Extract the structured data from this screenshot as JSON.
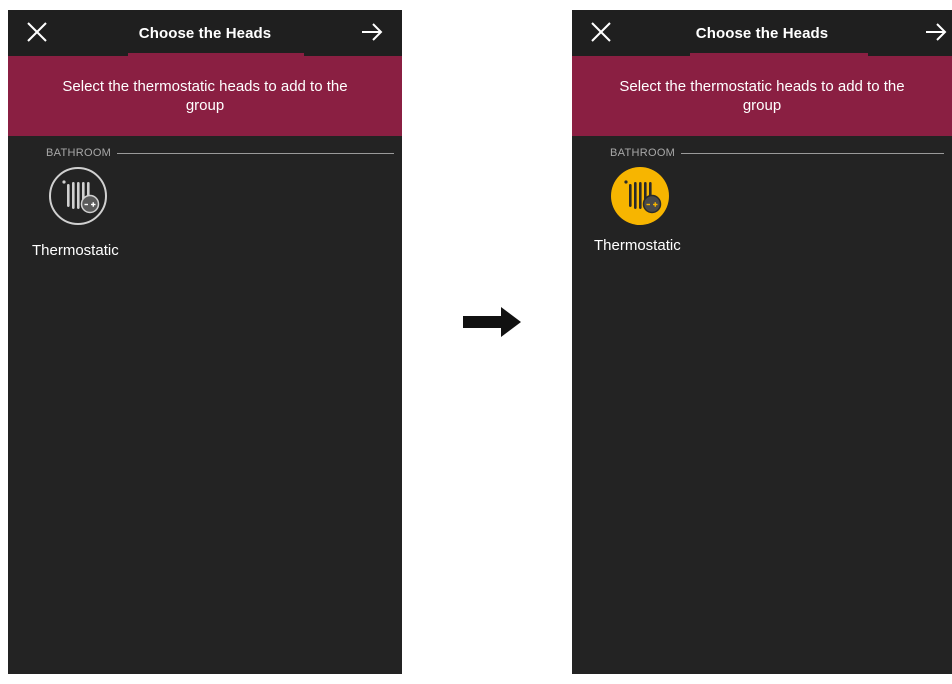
{
  "screens": [
    {
      "state": "unselected",
      "header": {
        "title": "Choose the Heads",
        "close_icon": "close-icon",
        "next_icon": "arrow-right-icon"
      },
      "banner": {
        "text": "Select the thermostatic heads to add to the group"
      },
      "section": {
        "label": "BATHROOM"
      },
      "device": {
        "name": "Thermostatic",
        "icon": "thermostatic-head-icon",
        "selected": false
      }
    },
    {
      "state": "selected",
      "header": {
        "title": "Choose the Heads",
        "close_icon": "close-icon",
        "next_icon": "arrow-right-icon"
      },
      "banner": {
        "text": "Select the thermostatic heads to add to the group"
      },
      "section": {
        "label": "BATHROOM"
      },
      "device": {
        "name": "Thermostatic",
        "icon": "thermostatic-head-icon",
        "selected": true
      }
    }
  ],
  "transition_icon": "arrow-right-icon",
  "colors": {
    "background": "#232323",
    "header": "#1f1f1f",
    "accent": "#8a1f42",
    "selected": "#f7b500",
    "text": "#ffffff",
    "muted": "#a8a8a8"
  }
}
